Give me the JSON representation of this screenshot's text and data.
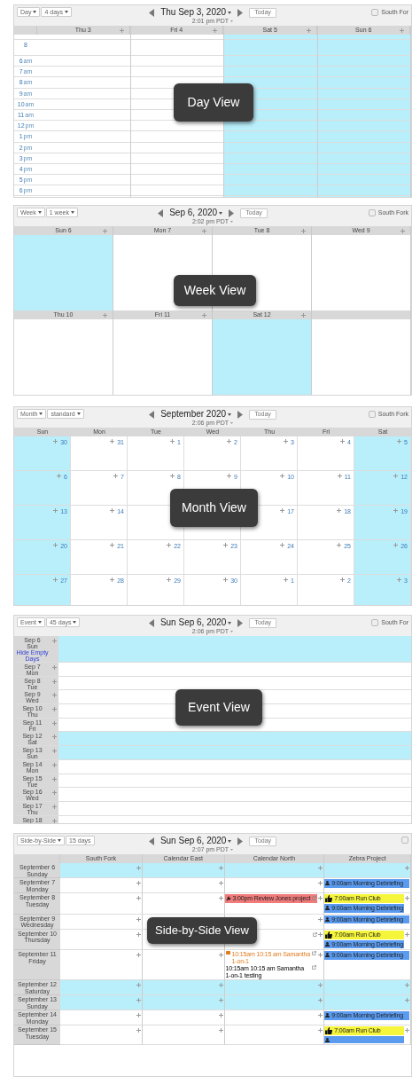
{
  "panels": [
    {
      "kind": "day",
      "view_buttons": [
        {
          "label": "Day",
          "caret": true
        },
        {
          "label": "4 days",
          "caret": true
        }
      ],
      "title": "Thu Sep 3, 2020",
      "time": "2:01 pm PDT",
      "today": "Today",
      "calendar": "South For",
      "overlay": "Day View",
      "columns": [
        {
          "label": "Thu 3",
          "weekend": false
        },
        {
          "label": "Fri 4",
          "weekend": false
        },
        {
          "label": "Sat 5",
          "weekend": true
        },
        {
          "label": "Sun 6",
          "weekend": true
        }
      ],
      "hours": [
        {
          "hour": "8"
        },
        {
          "hour": "6",
          "period": "am"
        },
        {
          "hour": "7",
          "period": "am"
        },
        {
          "hour": "8",
          "period": "am"
        },
        {
          "hour": "9",
          "period": "am"
        },
        {
          "hour": "10",
          "period": "am"
        },
        {
          "hour": "11",
          "period": "am"
        },
        {
          "hour": "12",
          "period": "pm"
        },
        {
          "hour": "1",
          "period": "pm"
        },
        {
          "hour": "2",
          "period": "pm"
        },
        {
          "hour": "3",
          "period": "pm"
        },
        {
          "hour": "4",
          "period": "pm"
        },
        {
          "hour": "5",
          "period": "pm"
        },
        {
          "hour": "6",
          "period": "pm"
        }
      ]
    },
    {
      "kind": "week",
      "view_buttons": [
        {
          "label": "Week",
          "caret": true
        },
        {
          "label": "1 week",
          "caret": true
        }
      ],
      "title": "Sep 6, 2020",
      "time": "2:02 pm PDT",
      "today": "Today",
      "calendar": "South Fork",
      "overlay": "Week View",
      "weeks": [
        {
          "days": [
            {
              "label": "Sun 6",
              "weekend": true
            },
            {
              "label": "Mon 7",
              "weekend": false
            },
            {
              "label": "Tue 8",
              "weekend": false
            },
            {
              "label": "Wed 9",
              "weekend": false
            }
          ]
        },
        {
          "days": [
            {
              "label": "Thu 10",
              "weekend": false
            },
            {
              "label": "Fri 11",
              "weekend": false
            },
            {
              "label": "Sat 12",
              "weekend": true
            },
            {
              "weekend": false
            }
          ]
        }
      ]
    },
    {
      "kind": "month",
      "view_buttons": [
        {
          "label": "Month",
          "caret": true
        },
        {
          "label": "standard",
          "caret": true
        }
      ],
      "title": "September 2020",
      "time": "2:06 pm PDT",
      "today": "Today",
      "calendar": "South Fork",
      "overlay": "Month View",
      "weekdays": [
        "Sun",
        "Mon",
        "Tue",
        "Wed",
        "Thu",
        "Fri",
        "Sat"
      ],
      "rows": [
        [
          {
            "date": "30",
            "weekend": true
          },
          {
            "date": "31",
            "weekend": false
          },
          {
            "date": "1",
            "weekend": false
          },
          {
            "date": "2",
            "weekend": false
          },
          {
            "date": "3",
            "weekend": false
          },
          {
            "date": "4",
            "weekend": false
          },
          {
            "date": "5",
            "weekend": true
          }
        ],
        [
          {
            "date": "6",
            "weekend": true
          },
          {
            "date": "7",
            "weekend": false
          },
          {
            "date": "8",
            "weekend": false
          },
          {
            "date": "9",
            "weekend": false
          },
          {
            "date": "10",
            "weekend": false
          },
          {
            "date": "11",
            "weekend": false
          },
          {
            "date": "12",
            "weekend": true
          }
        ],
        [
          {
            "date": "13",
            "weekend": true
          },
          {
            "date": "14",
            "weekend": false
          },
          {
            "weekend": false
          },
          {
            "weekend": false
          },
          {
            "date": "17",
            "weekend": false
          },
          {
            "date": "18",
            "weekend": false
          },
          {
            "date": "19",
            "weekend": true
          }
        ],
        [
          {
            "date": "20",
            "weekend": true
          },
          {
            "date": "21",
            "weekend": false
          },
          {
            "date": "22",
            "weekend": false
          },
          {
            "date": "23",
            "weekend": false
          },
          {
            "date": "24",
            "weekend": false
          },
          {
            "date": "25",
            "weekend": false
          },
          {
            "date": "26",
            "weekend": true
          }
        ],
        [
          {
            "date": "27",
            "weekend": true
          },
          {
            "date": "28",
            "weekend": false
          },
          {
            "date": "29",
            "weekend": false
          },
          {
            "date": "30",
            "weekend": false
          },
          {
            "date": "1",
            "weekend": false
          },
          {
            "date": "2",
            "weekend": false
          },
          {
            "date": "3",
            "weekend": true
          }
        ]
      ]
    },
    {
      "kind": "event",
      "view_buttons": [
        {
          "label": "Event",
          "caret": true
        },
        {
          "label": "45 days",
          "caret": true
        }
      ],
      "title": "Sun Sep 6, 2020",
      "time": "2:06 pm PDT",
      "today": "Today",
      "calendar": "South For",
      "overlay": "Event View",
      "days": [
        {
          "date": "Sep 6",
          "weekday": "Sun",
          "link": "Hide Empty Days",
          "weekend": true
        },
        {
          "date": "Sep 7",
          "weekday": "Mon",
          "weekend": false
        },
        {
          "date": "Sep 8",
          "weekday": "Tue",
          "weekend": false
        },
        {
          "date": "Sep 9",
          "weekday": "Wed",
          "weekend": false
        },
        {
          "date": "Sep 10",
          "weekday": "Thu",
          "weekend": false
        },
        {
          "date": "Sep 11",
          "weekday": "Fri",
          "weekend": false
        },
        {
          "date": "Sep 12",
          "weekday": "Sat",
          "weekend": true
        },
        {
          "date": "Sep 13",
          "weekday": "Sun",
          "weekend": true
        },
        {
          "date": "Sep 14",
          "weekday": "Mon",
          "weekend": false
        },
        {
          "date": "Sep 15",
          "weekday": "Tue",
          "weekend": false
        },
        {
          "date": "Sep 16",
          "weekday": "Wed",
          "weekend": false
        },
        {
          "date": "Sep 17",
          "weekday": "Thu",
          "weekend": false
        },
        {
          "date": "Sep 18",
          "weekend": false
        }
      ]
    },
    {
      "kind": "side",
      "view_buttons": [
        {
          "label": "Side-by-Side",
          "caret": true
        },
        {
          "label": "15 days",
          "caret": false
        }
      ],
      "title": "Sun Sep 6, 2020",
      "time": "2:07 pm PDT",
      "today": "Today",
      "overlay": "Side-by-Side View",
      "calendars": [
        "South Fork",
        "Calendar East",
        "Calendar North",
        "Zebra Project"
      ],
      "days": [
        {
          "date": "September 6",
          "weekday": "Sunday",
          "weekend": true,
          "cells": [
            {
              "plus": true
            },
            {
              "plus": true
            },
            {
              "plus": true
            },
            {
              "plus": true
            }
          ]
        },
        {
          "date": "September 7",
          "weekday": "Monday",
          "weekend": false,
          "cells": [
            {
              "plus": true
            },
            {
              "plus": true
            },
            {
              "plus": true
            },
            {
              "plus": false,
              "events": [
                {
                  "kind": "meeting",
                  "color": "#5b9bef",
                  "text": "9:00am Morning Debriefing"
                }
              ]
            }
          ]
        },
        {
          "date": "September 8",
          "weekday": "Tuesday",
          "weekend": false,
          "cells": [
            {
              "plus": true
            },
            {
              "plus": true
            },
            {
              "plus": true,
              "events": [
                {
                  "kind": "review",
                  "color": "#f17b7b",
                  "text": "3:00pm Review Jones project"
                }
              ]
            },
            {
              "plus": true,
              "events": [
                {
                  "kind": "club",
                  "color": "#f5f53c",
                  "text": "7:00am Run Club"
                },
                {
                  "kind": "meeting",
                  "color": "#5b9bef",
                  "text": "9:00am Morning Debriefing"
                }
              ]
            }
          ]
        },
        {
          "date": "September 9",
          "weekday": "Wednesday",
          "weekend": false,
          "cells": [
            {
              "plus": true
            },
            {
              "plus": false
            },
            {
              "plus": true
            },
            {
              "plus": false,
              "events": [
                {
                  "kind": "meeting",
                  "color": "#5b9bef",
                  "text": "9:00am Morning Debriefing"
                }
              ]
            }
          ]
        },
        {
          "date": "September 10",
          "weekday": "Thursday",
          "weekend": false,
          "cells": [
            {
              "plus": true
            },
            {
              "plus": false
            },
            {
              "plus": true,
              "link": true
            },
            {
              "plus": true,
              "events": [
                {
                  "kind": "club",
                  "color": "#f5f53c",
                  "text": "7:00am Run Club"
                },
                {
                  "kind": "meeting",
                  "color": "#5b9bef",
                  "text": "9:00am Morning Debriefing"
                }
              ]
            }
          ]
        },
        {
          "date": "September 11",
          "weekday": "Friday",
          "weekend": false,
          "cells": [
            {
              "plus": true
            },
            {
              "plus": true
            },
            {
              "plus": true,
              "events": [
                {
                  "kind": "reminder",
                  "color": "#e07b1f",
                  "text": "10:15am 10:15 am Samantha 1-on-1"
                },
                {
                  "kind": "note",
                  "text": "10:15am 10:15 am Samantha 1-on-1 testing"
                }
              ]
            },
            {
              "plus": false,
              "events": [
                {
                  "kind": "meeting",
                  "color": "#5b9bef",
                  "text": "9:00am Morning Debriefing"
                }
              ]
            }
          ]
        },
        {
          "date": "September 12",
          "weekday": "Saturday",
          "weekend": true,
          "cells": [
            {
              "plus": true
            },
            {
              "plus": true
            },
            {
              "plus": true
            },
            {
              "plus": true
            }
          ]
        },
        {
          "date": "September 13",
          "weekday": "Sunday",
          "weekend": true,
          "cells": [
            {
              "plus": true
            },
            {
              "plus": true
            },
            {
              "plus": true
            },
            {
              "plus": true
            }
          ]
        },
        {
          "date": "September 14",
          "weekday": "Monday",
          "weekend": false,
          "cells": [
            {
              "plus": true
            },
            {
              "plus": true
            },
            {
              "plus": true
            },
            {
              "plus": false,
              "events": [
                {
                  "kind": "meeting",
                  "color": "#5b9bef",
                  "text": "9:00am Morning Debriefing"
                }
              ]
            }
          ]
        },
        {
          "date": "September 15",
          "weekday": "Tuesday",
          "weekend": false,
          "cells": [
            {
              "plus": true
            },
            {
              "plus": true
            },
            {
              "plus": true
            },
            {
              "plus": true,
              "events": [
                {
                  "kind": "club",
                  "color": "#f5f53c",
                  "text": "7:00am Run Club"
                },
                {
                  "kind": "meeting",
                  "color": "#5b9bef"
                }
              ]
            }
          ]
        }
      ]
    }
  ]
}
